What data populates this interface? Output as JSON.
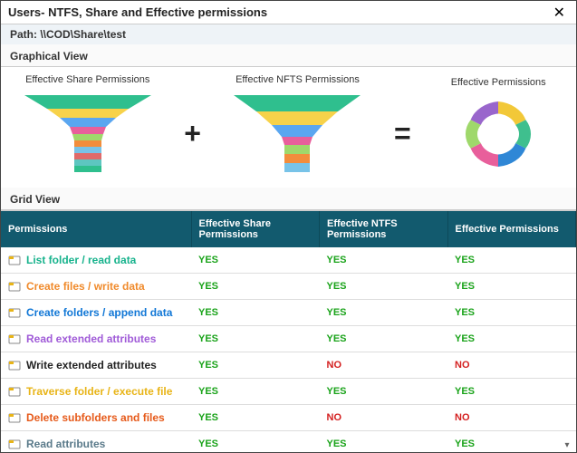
{
  "window": {
    "title": "Users- NTFS, Share and Effective permissions"
  },
  "path": {
    "label": "Path:",
    "value": "\\\\COD\\Share\\test"
  },
  "sections": {
    "graphical": "Graphical View",
    "grid": "Grid View"
  },
  "graphical": {
    "share": "Effective Share Permissions",
    "ntfs": "Effective NFTS Permissions",
    "effective": "Effective Permissions"
  },
  "operators": {
    "plus": "+",
    "equals": "="
  },
  "grid": {
    "headers": {
      "perm": "Permissions",
      "share": "Effective Share Permissions",
      "ntfs": "Effective NTFS Permissions",
      "eff": "Effective Permissions"
    },
    "values": {
      "yes": "YES",
      "no": "NO"
    },
    "rows": [
      {
        "icon": "folder-read",
        "color": "#18b38d",
        "name": "List folder / read data",
        "share": "YES",
        "ntfs": "YES",
        "eff": "YES"
      },
      {
        "icon": "file-write",
        "color": "#f08a2b",
        "name": "Create files / write data",
        "share": "YES",
        "ntfs": "YES",
        "eff": "YES"
      },
      {
        "icon": "folder-append",
        "color": "#1177d6",
        "name": "Create folders / append data",
        "share": "YES",
        "ntfs": "YES",
        "eff": "YES"
      },
      {
        "icon": "read-ext",
        "color": "#a05bd8",
        "name": "Read extended attributes",
        "share": "YES",
        "ntfs": "YES",
        "eff": "YES"
      },
      {
        "icon": "write-ext",
        "color": "#222222",
        "name": "Write extended attributes",
        "share": "YES",
        "ntfs": "NO",
        "eff": "NO"
      },
      {
        "icon": "traverse",
        "color": "#e8b417",
        "name": "Traverse folder / execute file",
        "share": "YES",
        "ntfs": "YES",
        "eff": "YES"
      },
      {
        "icon": "delete-sub",
        "color": "#e65a1a",
        "name": "Delete subfolders and files",
        "share": "YES",
        "ntfs": "NO",
        "eff": "NO"
      },
      {
        "icon": "read-attr",
        "color": "#5a7a8a",
        "name": "Read attributes",
        "share": "YES",
        "ntfs": "YES",
        "eff": "YES"
      }
    ]
  }
}
